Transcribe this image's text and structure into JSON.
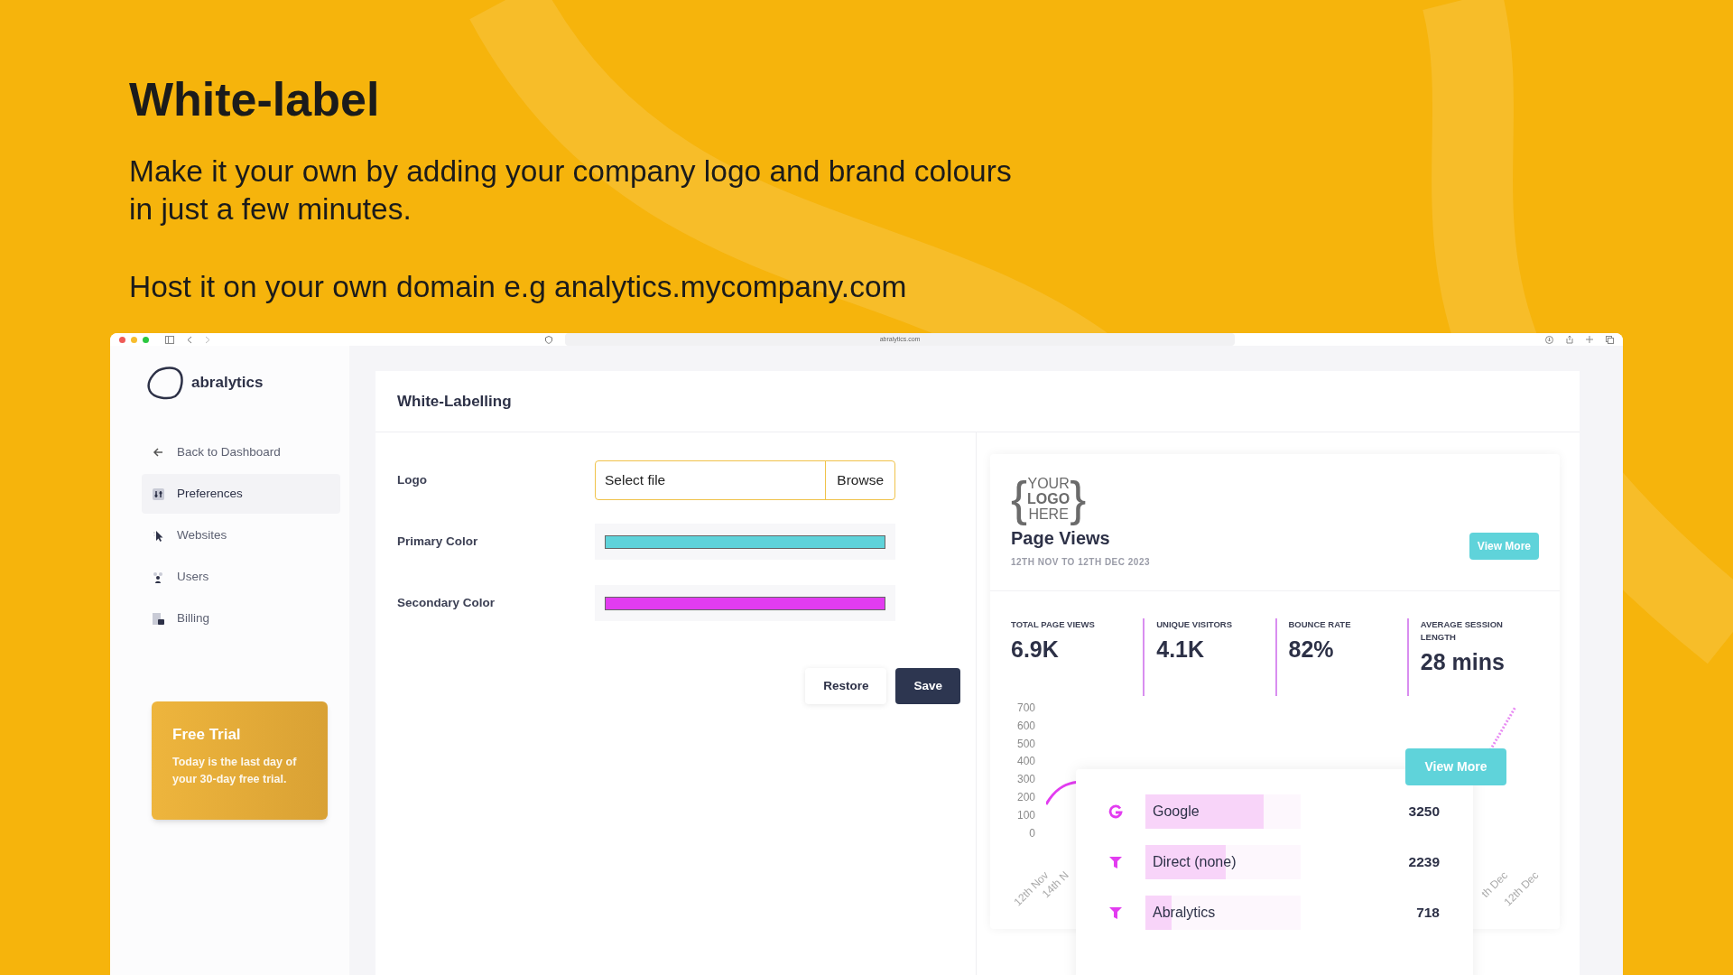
{
  "hero": {
    "title": "White-label",
    "lines": [
      "Make it your own by adding your company logo and brand colours",
      "in just a few minutes."
    ],
    "domain_text": "Host it on your own domain e.g analytics.mycompany.com"
  },
  "browser": {
    "address": "abralytics.com"
  },
  "sidebar": {
    "brand": "abralytics",
    "items": [
      {
        "label": "Back to Dashboard",
        "kind": "back",
        "selected": false
      },
      {
        "label": "Preferences",
        "kind": "preferences",
        "selected": true
      },
      {
        "label": "Websites",
        "kind": "websites",
        "selected": false
      },
      {
        "label": "Users",
        "kind": "users",
        "selected": false
      },
      {
        "label": "Billing",
        "kind": "billing",
        "selected": false
      }
    ],
    "trial": {
      "title": "Free Trial",
      "text": "Today is the last day of your 30-day free trial."
    }
  },
  "panel": {
    "title": "White-Labelling",
    "fields": [
      {
        "label": "Logo",
        "kind": "file",
        "placeholder": "Select file",
        "button": "Browse"
      },
      {
        "label": "Primary Color",
        "kind": "color",
        "color": "#5fd3da"
      },
      {
        "label": "Secondary Color",
        "kind": "color",
        "color": "#e23cf0"
      }
    ],
    "buttons": [
      {
        "label": "Restore",
        "kind": "secondary"
      },
      {
        "label": "Save",
        "kind": "primary"
      }
    ]
  },
  "preview": {
    "logo_lines": [
      "YOUR",
      "LOGO",
      "HERE"
    ],
    "logo_braces": [
      "{",
      "}"
    ],
    "title": "Page Views",
    "date_range": "12TH NOV TO 12TH DEC 2023",
    "button": "View More",
    "stats": [
      {
        "label": "TOTAL PAGE VIEWS",
        "value": "6.9K"
      },
      {
        "label": "UNIQUE VISITORS",
        "value": "4.1K"
      },
      {
        "label": "BOUNCE RATE",
        "value": "82%"
      },
      {
        "label": "AVERAGE SESSION LENGTH",
        "value": "28 mins"
      }
    ],
    "chart": {
      "y_ticks": [
        "700",
        "600",
        "500",
        "400",
        "300",
        "200",
        "100",
        "0"
      ],
      "x_labels": [
        "12th Nov",
        "14th N",
        "th Dec",
        "12th Dec"
      ]
    },
    "popup": {
      "button": "View More",
      "rows": [
        {
          "label": "Google",
          "value": "3250",
          "kind": "google",
          "level": 0.76
        },
        {
          "label": "Direct (none)",
          "value": "2239",
          "kind": "funnel",
          "level": 0.52
        },
        {
          "label": "Abralytics",
          "value": "718",
          "kind": "funnel",
          "level": 0.17
        }
      ]
    }
  }
}
